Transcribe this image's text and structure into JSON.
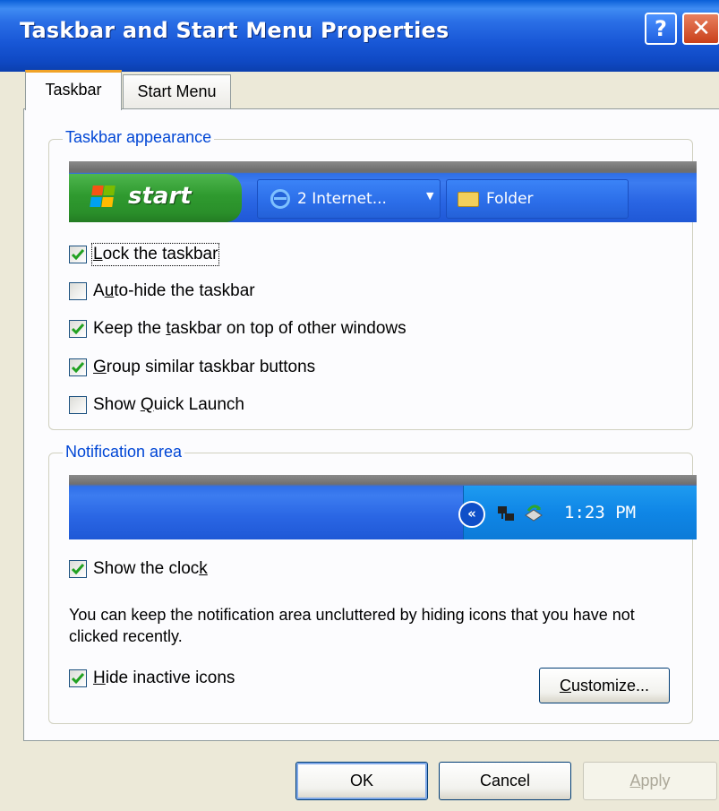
{
  "window": {
    "title": "Taskbar and Start Menu Properties",
    "help_button": "?",
    "close_button": "✕"
  },
  "tabs": [
    {
      "label": "Taskbar",
      "selected": true
    },
    {
      "label": "Start Menu",
      "selected": false
    }
  ],
  "taskbar_appearance": {
    "legend": "Taskbar appearance",
    "preview": {
      "start_label": "start",
      "buttons": [
        {
          "label": "2 Internet...",
          "icon": "ie-icon"
        },
        {
          "label": "Folder",
          "icon": "folder-icon"
        }
      ]
    },
    "options": [
      {
        "pre": "",
        "key": "L",
        "post": "ock the taskbar",
        "checked": true
      },
      {
        "pre": "A",
        "key": "u",
        "post": "to-hide the taskbar",
        "checked": false
      },
      {
        "pre": "Keep the ",
        "key": "t",
        "post": "askbar on top of other windows",
        "checked": true
      },
      {
        "pre": "",
        "key": "G",
        "post": "roup similar taskbar buttons",
        "checked": true
      },
      {
        "pre": "Show ",
        "key": "Q",
        "post": "uick Launch",
        "checked": false
      }
    ]
  },
  "notification_area": {
    "legend": "Notification area",
    "preview": {
      "chevron": "«",
      "clock": "1:23 PM",
      "icons": [
        "network-icon",
        "sync-icon"
      ]
    },
    "show_clock": {
      "pre": "Show the cloc",
      "key": "k",
      "post": "",
      "checked": true
    },
    "description": "You can keep the notification area uncluttered by hiding icons that you have not clicked recently.",
    "hide_inactive": {
      "pre": "",
      "key": "H",
      "post": "ide inactive icons",
      "checked": true
    },
    "customize_button": {
      "pre": "",
      "key": "C",
      "post": "ustomize..."
    }
  },
  "buttons": {
    "ok": "OK",
    "cancel": "Cancel",
    "apply": {
      "pre": "",
      "key": "A",
      "post": "pply",
      "enabled": false
    }
  },
  "colors": {
    "titlebar": "#0b55d8",
    "dialog_bg": "#ece9d8",
    "group_legend": "#0046d5",
    "start_button": "#2f9a2f",
    "taskbar_blue": "#2a66e4",
    "tab_highlight": "#f1a328"
  }
}
